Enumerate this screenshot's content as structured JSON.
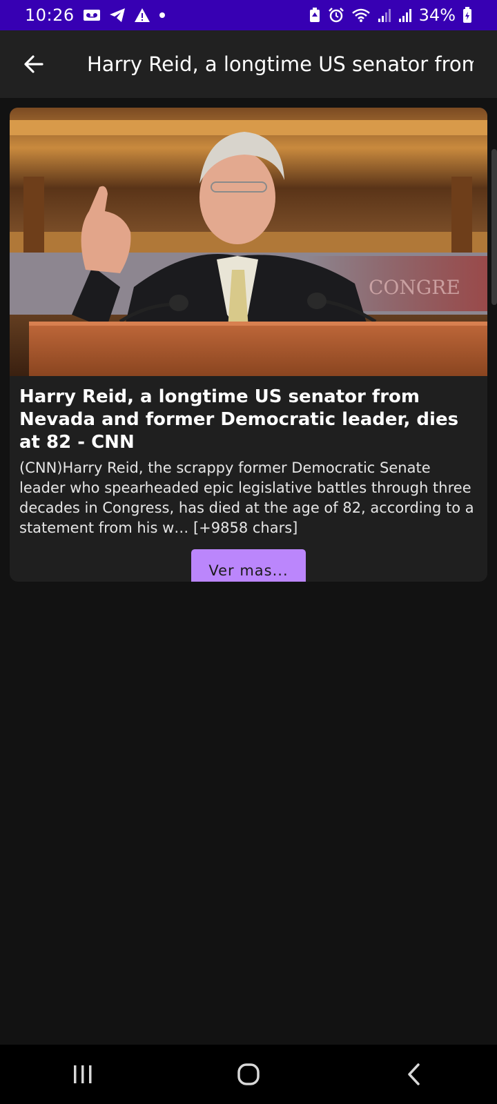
{
  "status_bar": {
    "time": "10:26",
    "battery_text": "34%",
    "left_icons": [
      "voicemail-icon",
      "telegram-icon",
      "warning-icon",
      "dot-icon"
    ],
    "right_icons": [
      "battery-saver-icon",
      "alarm-icon",
      "wifi-icon",
      "signal-icon",
      "signal-icon",
      "battery-charging-icon"
    ],
    "color": "#3700b3"
  },
  "app_bar": {
    "title": "Harry Reid, a longtime US senator from",
    "back_icon": "arrow-left-icon",
    "color": "#212121"
  },
  "article": {
    "title": "Harry Reid, a longtime US senator from Nevada and former Democratic leader, dies at 82 - CNN",
    "description": "(CNN)Harry Reid, the scrappy former Democratic Senate leader who spearheaded epic legislative battles through three decades in Congress, has died at the age of 82, according to a statement from his w… [+9858 chars]",
    "image_alt": "Photo of Harry Reid speaking at a podium",
    "button_label": "Ver mas...",
    "button_color": "#bb86fc"
  },
  "nav_bar": {
    "buttons": [
      "recents-icon",
      "home-icon",
      "back-icon"
    ]
  }
}
